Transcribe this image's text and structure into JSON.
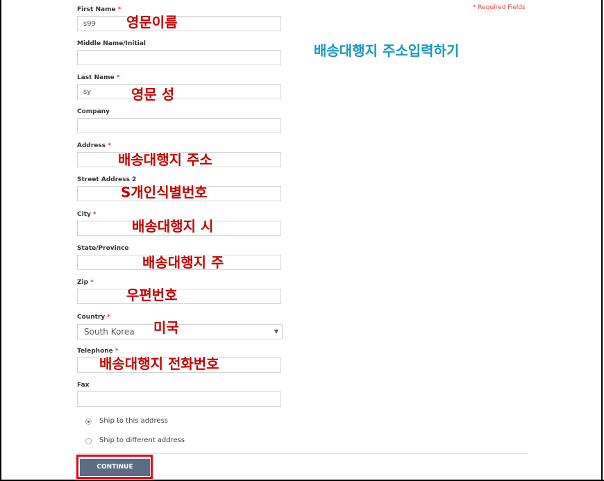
{
  "required_note": "* Required Fields",
  "required_mark": "*",
  "fields": {
    "first_name": {
      "label": "First Name",
      "value": "s99"
    },
    "middle_name": {
      "label": "Middle Name/Initial",
      "value": ""
    },
    "last_name": {
      "label": "Last Name",
      "value": "sy"
    },
    "company": {
      "label": "Company",
      "value": ""
    },
    "address": {
      "label": "Address",
      "value": ""
    },
    "street_address_2": {
      "label": "Street Address 2",
      "value": ""
    },
    "city": {
      "label": "City",
      "value": ""
    },
    "state": {
      "label": "State/Province",
      "value": ""
    },
    "zip": {
      "label": "Zip",
      "value": ""
    },
    "country": {
      "label": "Country",
      "value": "South Korea"
    },
    "telephone": {
      "label": "Telephone",
      "value": ""
    },
    "fax": {
      "label": "Fax",
      "value": ""
    }
  },
  "shipping_options": {
    "ship_to_this": "Ship to this address",
    "ship_to_different": "Ship to different address",
    "selected": "ship_to_this"
  },
  "continue_label": "CONTINUE",
  "annotations": {
    "title": "배송대행지 주소입력하기",
    "first_name": "영문이름",
    "last_name": "영문 성",
    "address": "배송대행지 주소",
    "street_address_2": "S개인식별번호",
    "city": "배송대행지 시",
    "state": "배송대행지 주",
    "zip": "우편번호",
    "country": "미국",
    "telephone": "배송대행지 전화번호"
  },
  "colors": {
    "annotation_red": "#c40000",
    "annotation_blue": "#1698be",
    "required_red": "#e63b3b",
    "button_bg": "#5a6d85",
    "highlight_border": "#e8001a"
  }
}
